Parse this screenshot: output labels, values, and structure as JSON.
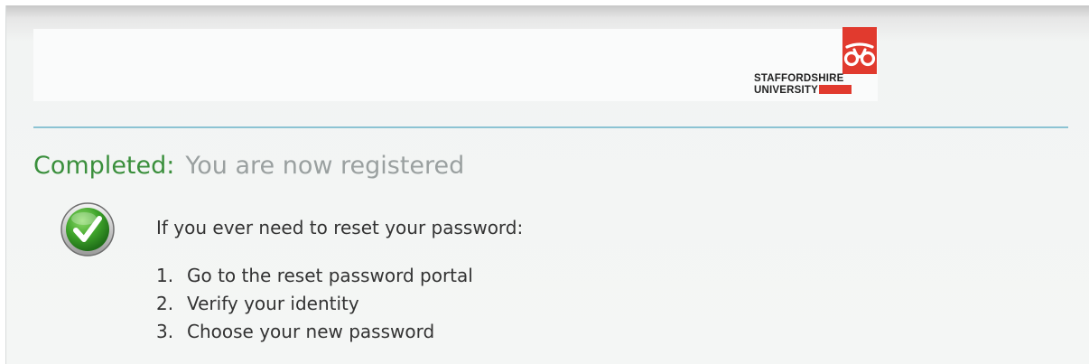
{
  "header": {
    "logo": {
      "line1": "STAFFORDSHIRE",
      "line2": "UNIVERSITY",
      "brand_color": "#e13a2e"
    }
  },
  "status": {
    "label": "Completed:",
    "message": "You are now registered",
    "icon": "check-circle-icon",
    "color": "#3a8f3c"
  },
  "instructions": {
    "intro": "If you ever need to reset your password:",
    "steps": [
      {
        "number": "1.",
        "text": "Go to the reset password portal"
      },
      {
        "number": "2.",
        "text": "Verify your identity"
      },
      {
        "number": "3.",
        "text": "Choose your new password"
      }
    ]
  },
  "colors": {
    "divider": "#8cc3d3",
    "body_text": "#333333",
    "muted_text": "#9aa0a0"
  }
}
